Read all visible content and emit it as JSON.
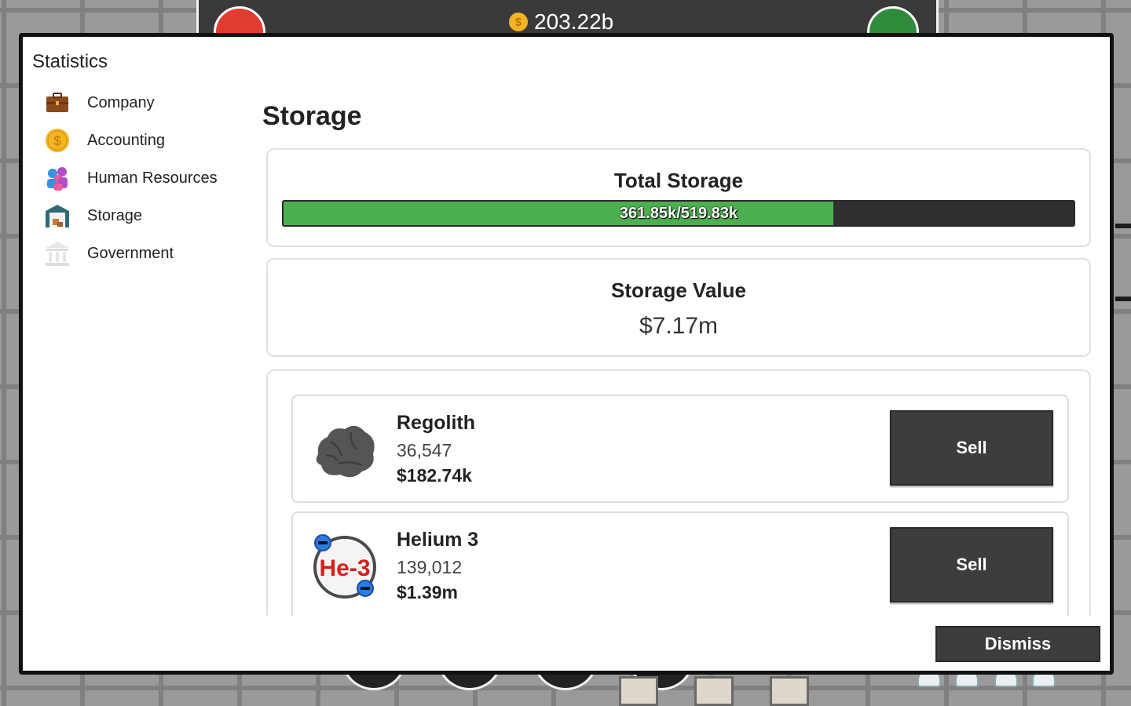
{
  "hud": {
    "money": "203.22b",
    "coin_symbol": "$"
  },
  "dialog": {
    "title": "Statistics",
    "sidebar": [
      {
        "label": "Company",
        "icon": "briefcase-icon"
      },
      {
        "label": "Accounting",
        "icon": "coin-icon"
      },
      {
        "label": "Human Resources",
        "icon": "people-icon"
      },
      {
        "label": "Storage",
        "icon": "warehouse-icon"
      },
      {
        "label": "Government",
        "icon": "government-building-icon"
      }
    ],
    "coin_symbol": "$",
    "section_title": "Storage",
    "total_storage": {
      "title": "Total Storage",
      "text": "361.85k/519.83k",
      "used": 361.85,
      "capacity": 519.83
    },
    "storage_value": {
      "title": "Storage Value",
      "value": "$7.17m"
    },
    "items": [
      {
        "name": "Regolith",
        "quantity": "36,547",
        "value": "$182.74k",
        "icon": "regolith-rock-icon",
        "button": "Sell"
      },
      {
        "name": "Helium 3",
        "quantity": "139,012",
        "value": "$1.39m",
        "icon": "helium3-icon",
        "icon_text": "He-3",
        "button": "Sell"
      }
    ],
    "dismiss_label": "Dismiss"
  },
  "colors": {
    "progress_fill": "#4caf50",
    "button_dark": "#3d3d3d",
    "coin": "#f3b524"
  }
}
